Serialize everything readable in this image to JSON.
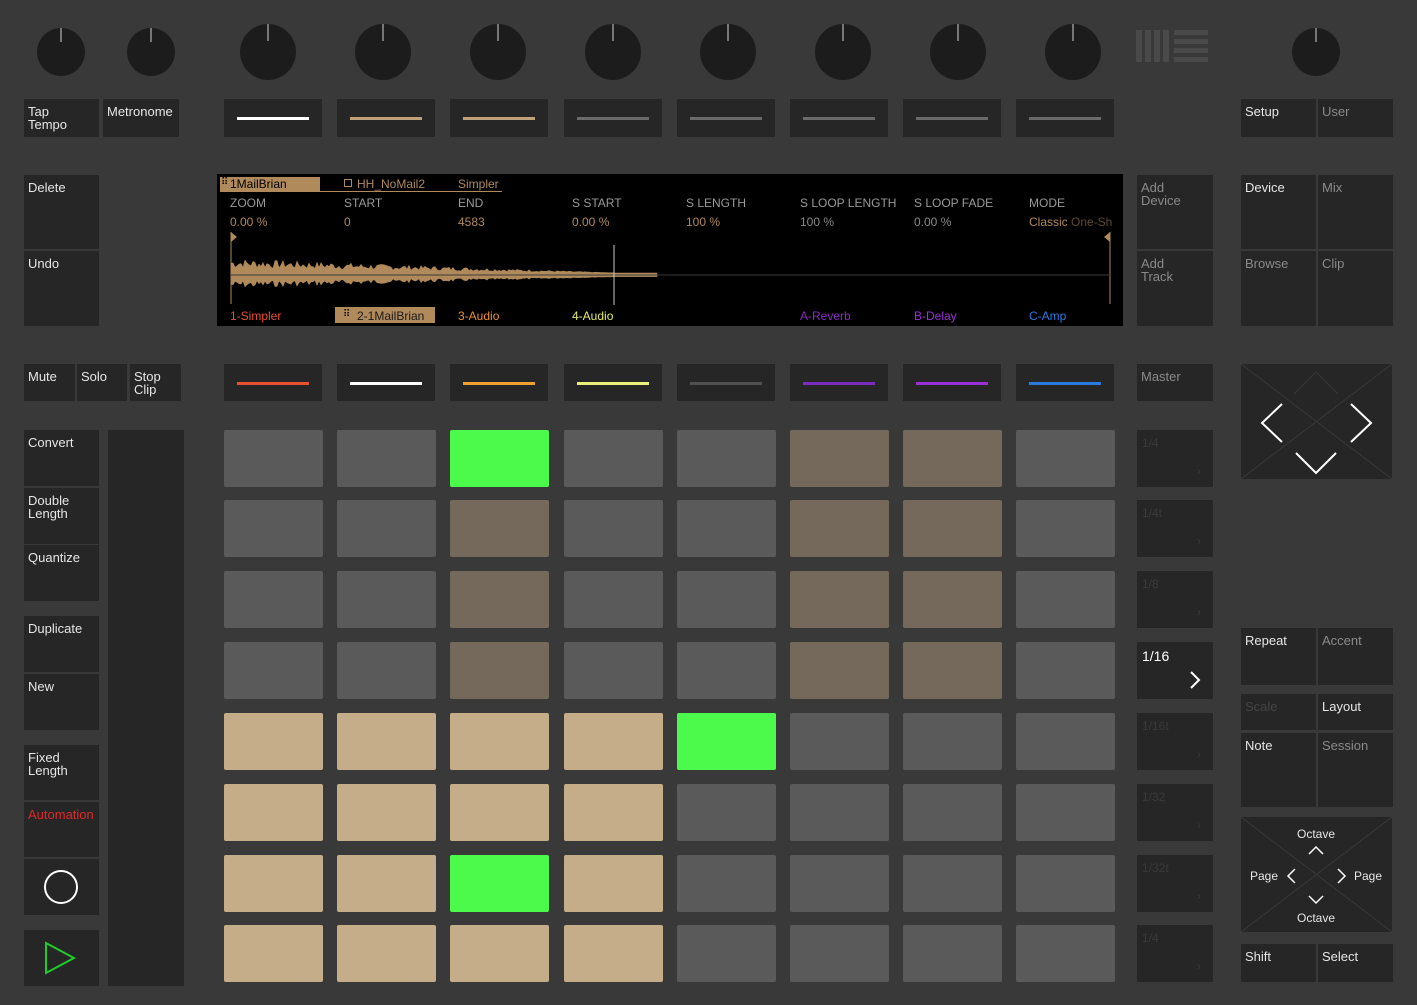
{
  "left_buttons": {
    "tap_tempo": "Tap\nTempo",
    "metronome": "Metronome",
    "delete": "Delete",
    "undo": "Undo",
    "mute": "Mute",
    "solo": "Solo",
    "stop_clip": "Stop\nClip",
    "convert": "Convert",
    "double_length": "Double\nLength",
    "quantize": "Quantize",
    "duplicate": "Duplicate",
    "new": "New",
    "fixed_length": "Fixed\nLength",
    "automation": "Automation"
  },
  "right_buttons": {
    "setup": "Setup",
    "user": "User",
    "add_device": "Add\nDevice",
    "add_track": "Add\nTrack",
    "device": "Device",
    "mix": "Mix",
    "browse": "Browse",
    "clip": "Clip",
    "master": "Master",
    "repeat": "Repeat",
    "accent": "Accent",
    "scale": "Scale",
    "layout": "Layout",
    "note": "Note",
    "session": "Session",
    "shift": "Shift",
    "select": "Select"
  },
  "nav_pad": {
    "octave_up": "Octave",
    "octave_down": "Octave",
    "page_left": "Page",
    "page_right": "Page"
  },
  "display": {
    "tabs": [
      "1MailBrian",
      "HH_NoMail2",
      "Simpler"
    ],
    "params": [
      {
        "name": "ZOOM",
        "value": "0.00 %"
      },
      {
        "name": "START",
        "value": "0"
      },
      {
        "name": "END",
        "value": "4583"
      },
      {
        "name": "S START",
        "value": "0.00 %"
      },
      {
        "name": "S LENGTH",
        "value": "100 %"
      },
      {
        "name": "S LOOP LENGTH",
        "value": "100 %"
      },
      {
        "name": "S LOOP FADE",
        "value": "0.00 %"
      },
      {
        "name": "MODE",
        "value": "Classic",
        "value_extra": "One-Sh"
      }
    ],
    "tracks": [
      {
        "name": "1-Simpler",
        "color": "#e8502e"
      },
      {
        "name": "2-1MailBrian",
        "color": "#1a1a1a",
        "selected": true
      },
      {
        "name": "3-Audio",
        "color": "#e8902e"
      },
      {
        "name": "4-Audio",
        "color": "#e2ea6a"
      },
      {
        "name": "",
        "color": "#000000"
      },
      {
        "name": "A-Reverb",
        "color": "#8a2cc0"
      },
      {
        "name": "B-Delay",
        "color": "#9a30d8"
      },
      {
        "name": "C-Amp",
        "color": "#2a7ae0"
      }
    ]
  },
  "scenes": [
    "1/4",
    "1/4t",
    "1/8",
    "1/8t",
    "1/16",
    "1/16t",
    "1/32",
    "1/32t"
  ],
  "scene_active": "1/16",
  "upper_row_colors": [
    "#ffffff",
    "#c0a27a",
    "#c0a27a",
    "#6a6a6a",
    "#6a6a6a",
    "#6a6a6a",
    "#6a6a6a",
    "#6a6a6a"
  ],
  "lower_row_colors": [
    "#e8502e",
    "#ffffff",
    "#f0a030",
    "#eaf07a",
    "#505050",
    "#7a2cc0",
    "#9a30d8",
    "#2a7ae0"
  ],
  "pad_colors": {
    "g": "#5a5a5a",
    "b": "#74695a",
    "t": "#c4ad88",
    "G": "#4cfa4c"
  },
  "pads": [
    [
      "g",
      "g",
      "G",
      "g",
      "g",
      "b",
      "b",
      "g"
    ],
    [
      "g",
      "g",
      "b",
      "g",
      "g",
      "b",
      "b",
      "g"
    ],
    [
      "g",
      "g",
      "b",
      "g",
      "g",
      "b",
      "b",
      "g"
    ],
    [
      "g",
      "g",
      "b",
      "g",
      "g",
      "b",
      "b",
      "g"
    ],
    [
      "t",
      "t",
      "t",
      "t",
      "G",
      "g",
      "g",
      "g"
    ],
    [
      "t",
      "t",
      "t",
      "t",
      "g",
      "g",
      "g",
      "g"
    ],
    [
      "t",
      "t",
      "G",
      "t",
      "g",
      "g",
      "g",
      "g"
    ],
    [
      "t",
      "t",
      "t",
      "t",
      "g",
      "g",
      "g",
      "g"
    ]
  ],
  "colors": {
    "background": "#393939",
    "button": "#262626",
    "accent_tan": "#c0a27a",
    "play_green": "#1fcc2a",
    "automation_red": "#e0282a"
  }
}
